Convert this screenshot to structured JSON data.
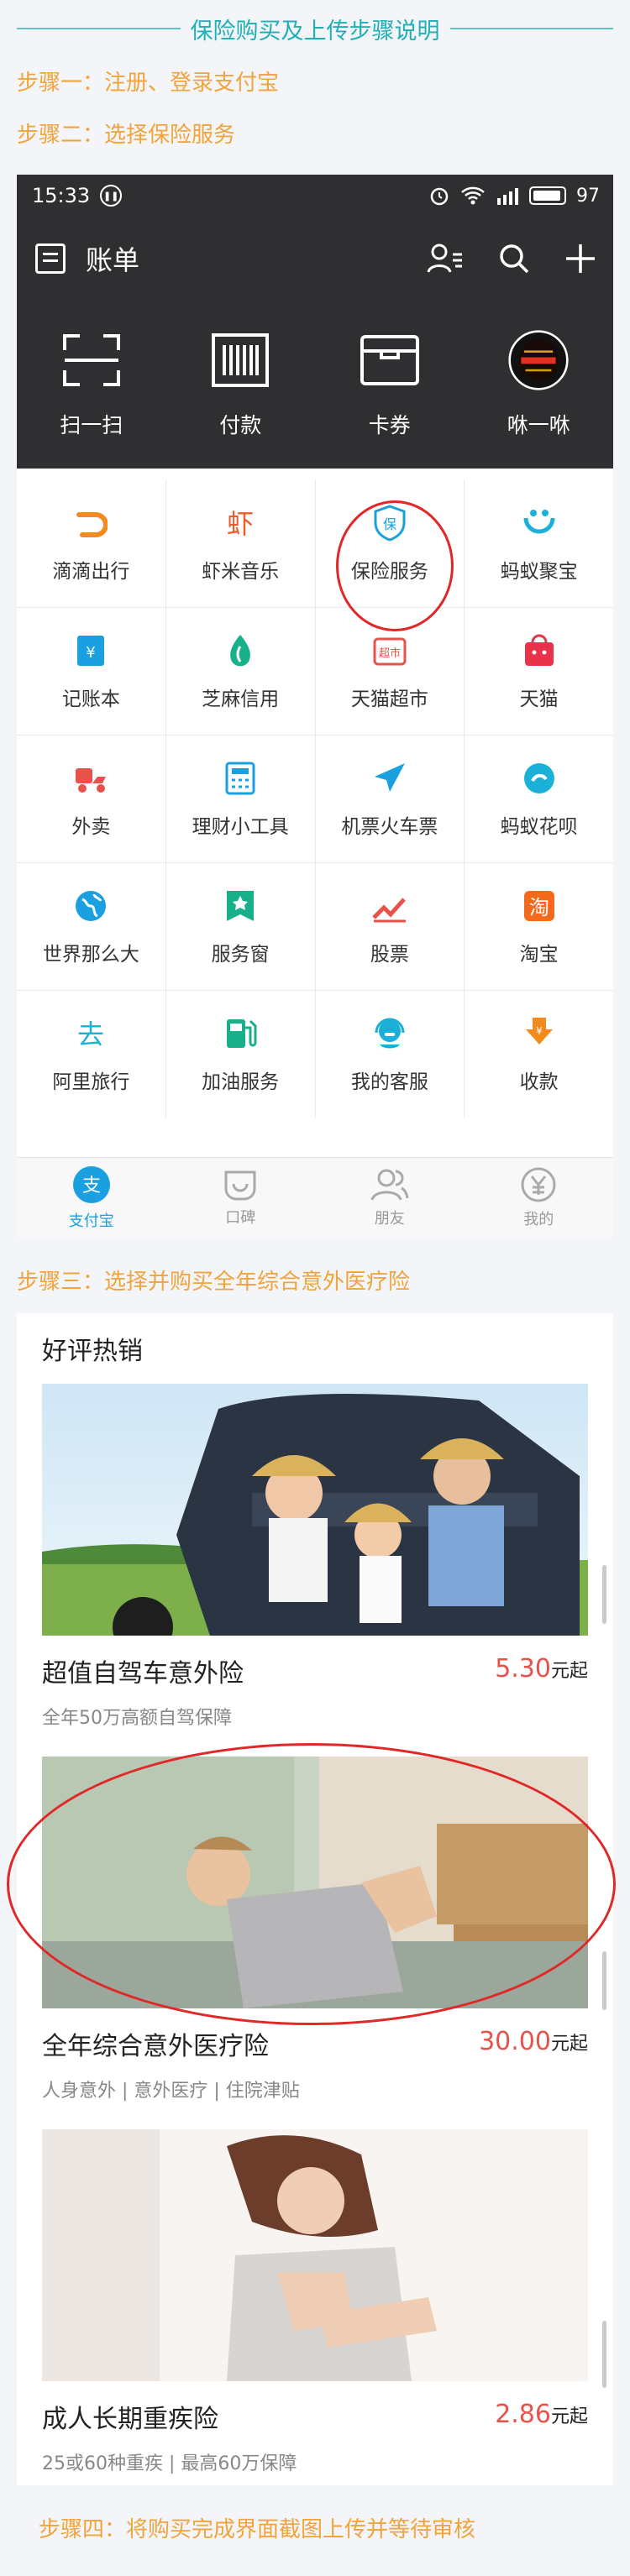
{
  "page_title": "保险购买及上传步骤说明",
  "steps": {
    "step1": "步骤一：注册、登录支付宝",
    "step2": "步骤二：选择保险服务",
    "step3": "步骤三：选择并购买全年综合意外医疗险",
    "step4": "步骤四：将购买完成界面截图上传并等待审核"
  },
  "accent_colors": {
    "teal": "#1fb0b6",
    "orange": "#f1a43c",
    "red_circle": "#e02828",
    "price": "#e8524a",
    "alipay_blue": "#1a9fe0"
  },
  "statusbar": {
    "time": "15:33",
    "battery": "97"
  },
  "header": {
    "title": "账单",
    "icons": [
      "bill-icon",
      "contacts-icon",
      "search-icon",
      "plus-icon"
    ]
  },
  "quick_actions": [
    {
      "label": "扫一扫",
      "icon": "scan-icon"
    },
    {
      "label": "付款",
      "icon": "barcode-icon"
    },
    {
      "label": "卡券",
      "icon": "wallet-icon"
    },
    {
      "label": "咻一咻",
      "icon": "xiu-icon"
    }
  ],
  "services": [
    {
      "label": "滴滴出行",
      "icon": "didi-icon"
    },
    {
      "label": "虾米音乐",
      "icon": "xiami-icon"
    },
    {
      "label": "保险服务",
      "icon": "insurance-icon"
    },
    {
      "label": "蚂蚁聚宝",
      "icon": "jubao-icon"
    },
    {
      "label": "记账本",
      "icon": "ledger-icon"
    },
    {
      "label": "芝麻信用",
      "icon": "sesame-icon"
    },
    {
      "label": "天猫超市",
      "icon": "tmall-market-icon"
    },
    {
      "label": "天猫",
      "icon": "tmall-icon"
    },
    {
      "label": "外卖",
      "icon": "delivery-icon"
    },
    {
      "label": "理财小工具",
      "icon": "calculator-icon"
    },
    {
      "label": "机票火车票",
      "icon": "plane-icon"
    },
    {
      "label": "蚂蚁花呗",
      "icon": "huabei-icon"
    },
    {
      "label": "世界那么大",
      "icon": "globe-icon"
    },
    {
      "label": "服务窗",
      "icon": "service-window-icon"
    },
    {
      "label": "股票",
      "icon": "stock-icon"
    },
    {
      "label": "淘宝",
      "icon": "taobao-icon"
    },
    {
      "label": "阿里旅行",
      "icon": "alitrip-icon"
    },
    {
      "label": "加油服务",
      "icon": "fuel-icon"
    },
    {
      "label": "我的客服",
      "icon": "customer-service-icon"
    },
    {
      "label": "收款",
      "icon": "receive-money-icon"
    }
  ],
  "tabs": [
    {
      "label": "支付宝",
      "icon": "alipay-icon",
      "active": true
    },
    {
      "label": "口碑",
      "icon": "koubei-icon",
      "active": false
    },
    {
      "label": "朋友",
      "icon": "friends-icon",
      "active": false
    },
    {
      "label": "我的",
      "icon": "yen-icon",
      "active": false
    }
  ],
  "hot_section": {
    "title": "好评热销"
  },
  "products": [
    {
      "name": "超值自驾车意外险",
      "price": "5.30",
      "unit": "元起",
      "subtitle": "全年50万高额自驾保障"
    },
    {
      "name": "全年综合意外医疗险",
      "price": "30.00",
      "unit": "元起",
      "subtitle": "人身意外 | 意外医疗 | 住院津贴"
    },
    {
      "name": "成人长期重疾险",
      "price": "2.86",
      "unit": "元起",
      "subtitle": "25或60种重疾 | 最高60万保障"
    }
  ]
}
